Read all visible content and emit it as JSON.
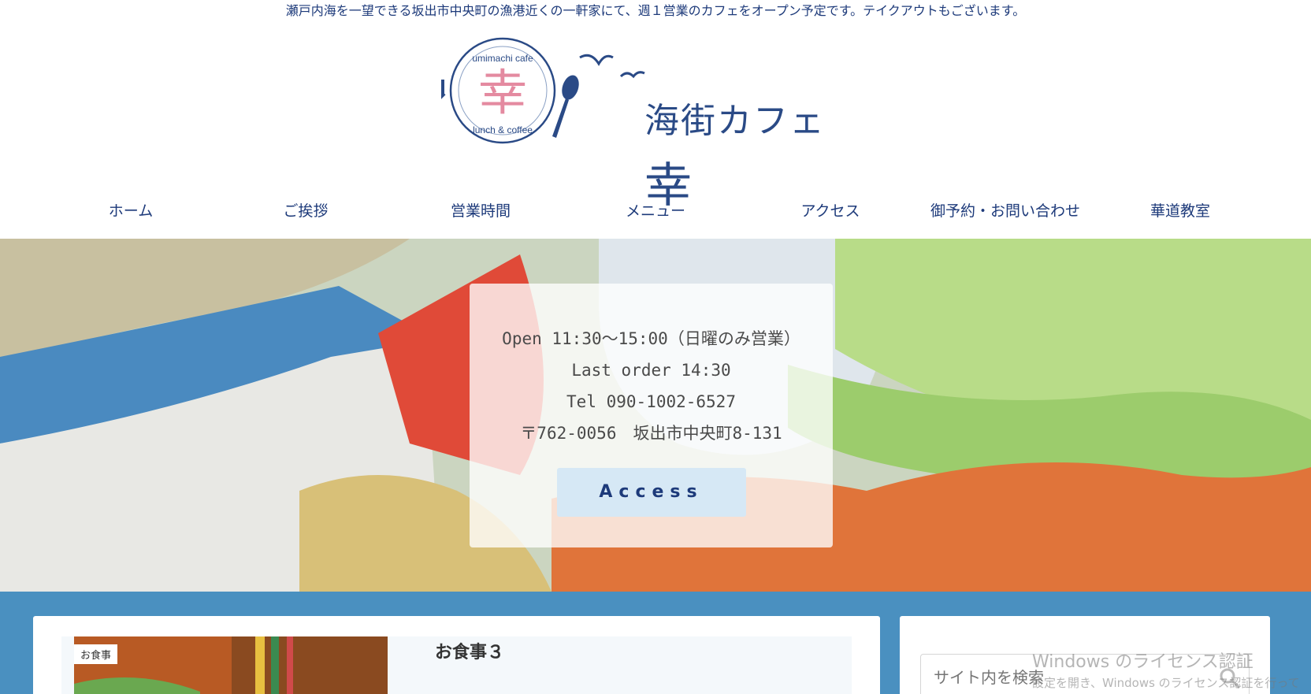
{
  "site": {
    "tagline": "瀬戸内海を一望できる坂出市中央町の漁港近くの一軒家にて、週１営業のカフェをオープン予定です。テイクアウトもございます。",
    "logo": {
      "emblem_top": "umimachi cafe",
      "emblem_bottom": "lunch & coffee",
      "name": "海街カフェ",
      "name_kanji": "幸"
    }
  },
  "nav": {
    "items": [
      {
        "label": "ホーム"
      },
      {
        "label": "ご挨拶"
      },
      {
        "label": "営業時間"
      },
      {
        "label": "メニュー"
      },
      {
        "label": "アクセス"
      },
      {
        "label": "御予約・お問い合わせ"
      },
      {
        "label": "華道教室"
      }
    ]
  },
  "hero": {
    "hours": "Open 11:30〜15:00（日曜のみ営業）",
    "last_order": "Last order 14:30",
    "tel": "Tel 090-1002-6527",
    "address": "〒762-0056　坂出市中央町8-131",
    "access_button": "Access"
  },
  "posts": [
    {
      "category": "お食事",
      "title": "お食事３"
    }
  ],
  "sidebar": {
    "search_placeholder": "サイト内を検索"
  },
  "overlay": {
    "windows_title": "Windows のライセンス認証",
    "windows_sub": "設定を開き、Windows のライセンス認証を行って"
  },
  "colors": {
    "brand": "#1d3a7a",
    "band": "#4a90c0",
    "button": "#d6e8f5"
  }
}
